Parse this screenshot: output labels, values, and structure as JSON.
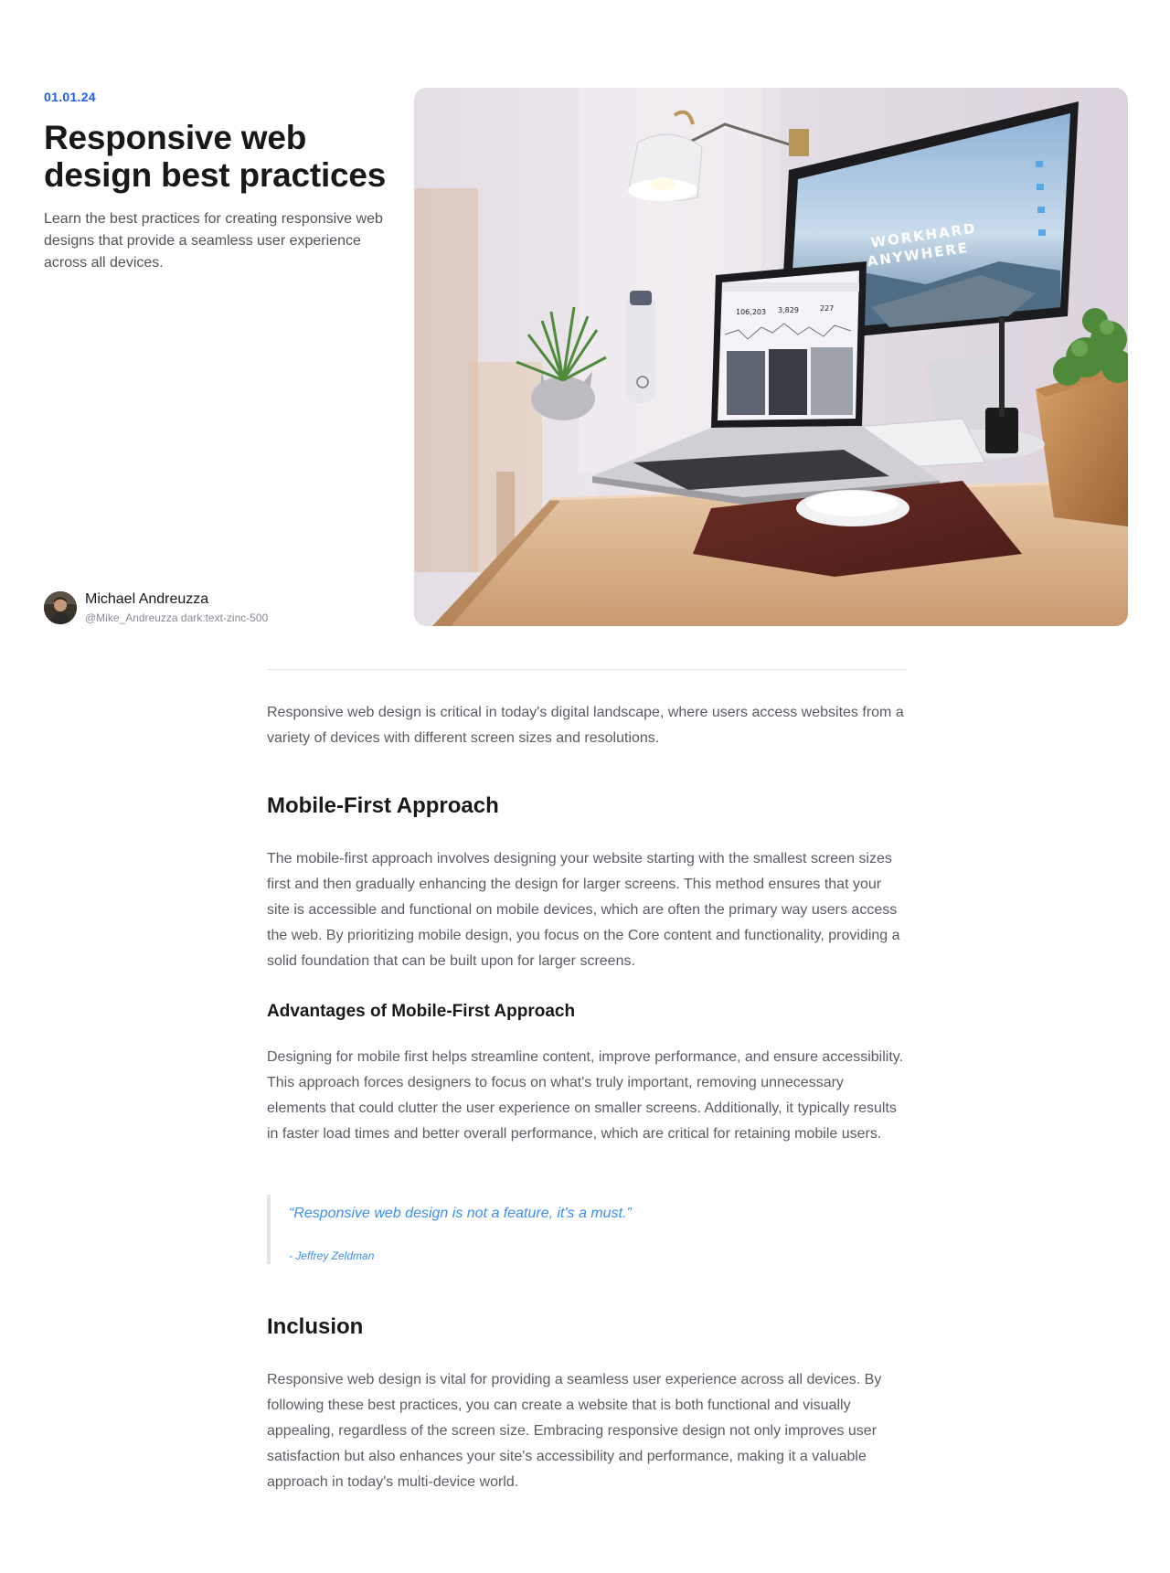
{
  "hero": {
    "date": "01.01.24",
    "title": "Responsive web design best practices",
    "lead": "Learn the best practices for creating responsive web designs that provide a seamless user experience across all devices.",
    "image": {
      "monitor_text_line1": "WORKHARD",
      "monitor_text_line2": "ANYWHERE",
      "laptop_stats": [
        "106,203",
        "3,829",
        "227"
      ]
    }
  },
  "author": {
    "name": "Michael Andreuzza",
    "handle": "@Mike_Andreuzza dark:text-zinc-500"
  },
  "article": {
    "intro": "Responsive web design is critical in today's digital landscape, where users access websites from a variety of devices with different screen sizes and resolutions.",
    "section1": {
      "heading": "Mobile-First Approach",
      "body": "The mobile-first approach involves designing your website starting with the smallest screen sizes first and then gradually enhancing the design for larger screens. This method ensures that your site is accessible and functional on mobile devices, which are often the primary way users access the web. By prioritizing mobile design, you focus on the Core content and functionality, providing a solid foundation that can be built upon for larger screens."
    },
    "subsection": {
      "heading": "Advantages of Mobile-First Approach",
      "body": "Designing for mobile first helps streamline content, improve performance, and ensure accessibility. This approach forces designers to focus on what's truly important, removing unnecessary elements that could clutter the user experience on smaller screens. Additionally, it typically results in faster load times and better overall performance, which are critical for retaining mobile users."
    },
    "quote": {
      "text": "“Responsive web design is not a feature, it's a must.”",
      "cite": "- Jeffrey Zeldman"
    },
    "section2": {
      "heading": "Inclusion",
      "body": "Responsive web design is vital for providing a seamless user experience across all devices. By following these best practices, you can create a website that is both functional and visually appealing, regardless of the screen size. Embracing responsive design not only improves user satisfaction but also enhances your site's accessibility and performance, making it a valuable approach in today's multi-device world."
    }
  },
  "colors": {
    "accent": "#1d5ff0",
    "quote": "#3b8ff0",
    "heading": "#18181b",
    "body": "#5b5b63",
    "muted": "#8a8a93",
    "divider": "#e4e4e7"
  }
}
